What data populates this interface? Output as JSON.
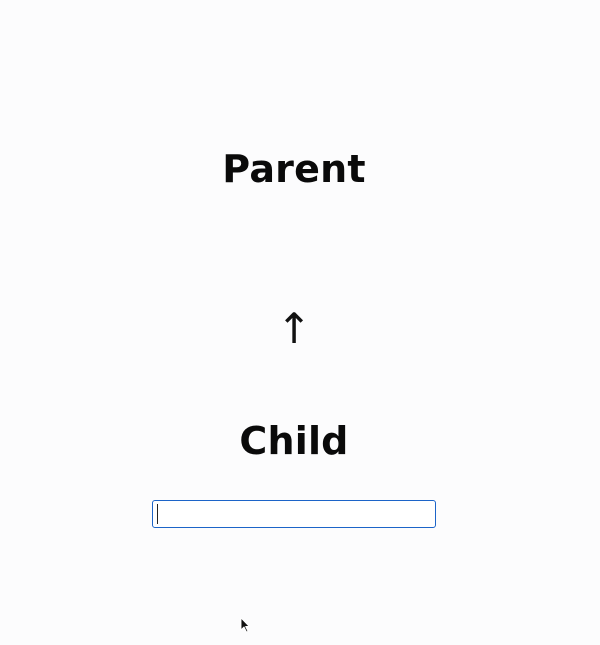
{
  "parent": {
    "title": "Parent"
  },
  "connector": {
    "arrow": "↑",
    "icon": "up-arrow-icon"
  },
  "child": {
    "title": "Child",
    "input_value": "",
    "input_placeholder": ""
  },
  "colors": {
    "background": "#fcfcfd",
    "text": "#0a0a0a",
    "input_focus_border": "#1c64c8"
  },
  "pointer": {
    "icon": "mouse-pointer-icon"
  }
}
